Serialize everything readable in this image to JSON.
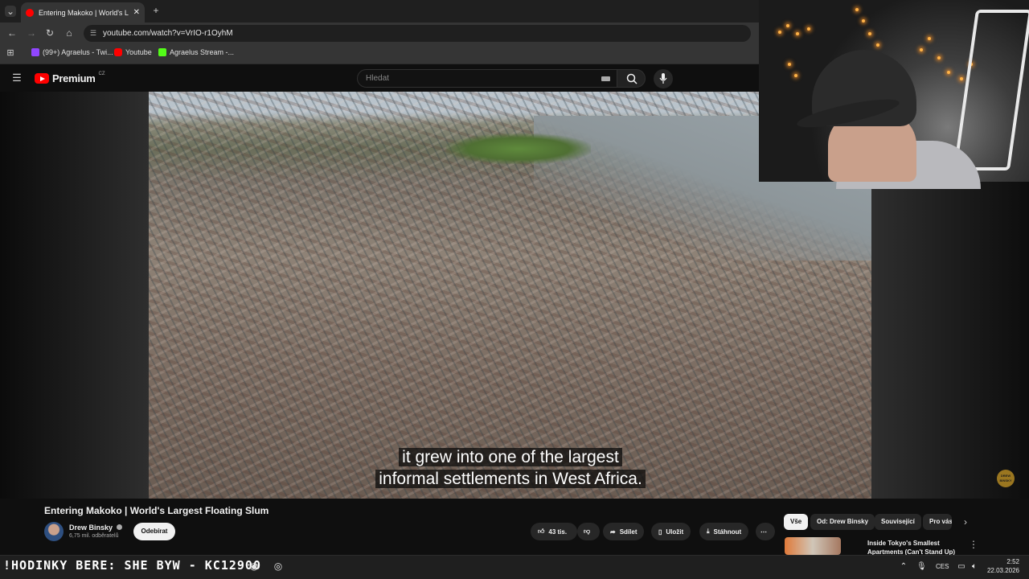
{
  "browser": {
    "tab_title": "Entering Makoko | World's Largest Floating Slum",
    "url": "youtube.com/watch?v=VrIO-r1OyhM",
    "bookmarks": [
      "(99+) Agraelus - Twi...",
      "Youtube",
      "Agraelus Stream -..."
    ]
  },
  "youtube": {
    "logo": "Premium",
    "region": "CZ",
    "search_placeholder": "Hledat"
  },
  "video": {
    "caption_line1": "it grew into one of the largest",
    "caption_line2": "informal settlements in West Africa.",
    "watermark": "DREW BINSKY",
    "title": "Entering Makoko | World's Largest Floating Slum",
    "channel": "Drew Binsky",
    "subscribers": "6,75 mil. odběratelů",
    "subscribe_label": "Odebírat",
    "likes": "43 tis.",
    "share_label": "Sdílet",
    "save_label": "Uložit",
    "download_label": "Stáhnout"
  },
  "sidebar": {
    "chips": [
      "Vše",
      "Od: Drew Binsky",
      "Související",
      "Pro vás"
    ],
    "suggestion_title": "Inside Tokyo's Smallest Apartments (Can't Stand Up)"
  },
  "taskbar": {
    "ticker": "!HODINKY BERE: SHE  BYW - KC12900",
    "language": "CES",
    "time": "2:52",
    "date": "22.03.2026"
  },
  "colors": {
    "accent": "#ff0000",
    "background": "#0f0f0f",
    "surface": "#272727"
  }
}
